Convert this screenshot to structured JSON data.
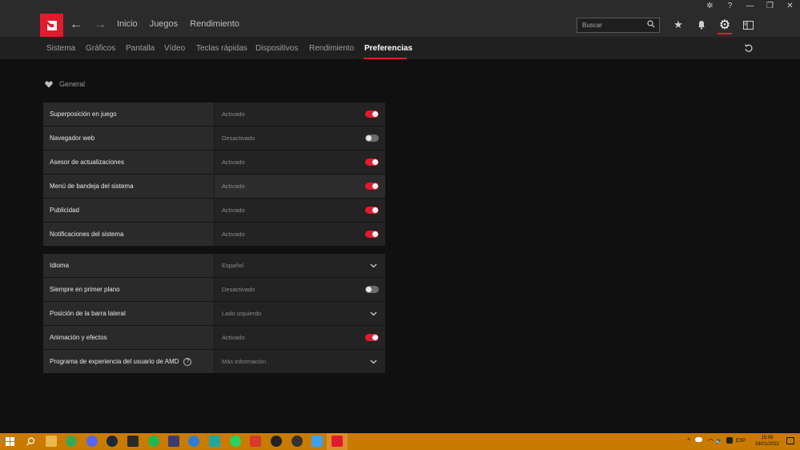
{
  "window": {
    "controls": [
      "bug-icon",
      "help-icon",
      "minimize-icon",
      "restore-icon",
      "close-icon"
    ]
  },
  "topbar": {
    "nav": [
      "Inicio",
      "Juegos",
      "Rendimiento"
    ],
    "search_placeholder": "Buscar",
    "icons": [
      "star-icon",
      "bell-icon",
      "gear-icon",
      "sidebar-icon"
    ]
  },
  "subtabs": [
    "Sistema",
    "Gráficos",
    "Pantalla",
    "Vídeo",
    "Teclas rápidas",
    "Dispositivos",
    "Rendimiento",
    "Preferencias"
  ],
  "active_subtab": "Preferencias",
  "section": {
    "title": "General",
    "icon": "heart-icon"
  },
  "panel1": [
    {
      "label": "Superposición en juego",
      "value": "Activado",
      "control": "toggle-on"
    },
    {
      "label": "Navegador web",
      "value": "Desactivado",
      "control": "toggle-off"
    },
    {
      "label": "Asesor de actualizaciones",
      "value": "Activado",
      "control": "toggle-on"
    },
    {
      "label": "Menú de bandeja del sistema",
      "value": "Activado",
      "control": "toggle-on"
    },
    {
      "label": "Publicidad",
      "value": "Activado",
      "control": "toggle-on"
    },
    {
      "label": "Notificaciones del sistema",
      "value": "Activado",
      "control": "toggle-on"
    }
  ],
  "panel2": [
    {
      "label": "Idioma",
      "value": "Español",
      "control": "dropdown"
    },
    {
      "label": "Siempre en primer plano",
      "value": "Desactivado",
      "control": "toggle-off"
    },
    {
      "label": "Posición de la barra lateral",
      "value": "Lado izquierdo",
      "control": "dropdown"
    },
    {
      "label": "Animación y efectos",
      "value": "Activado",
      "control": "toggle-on"
    },
    {
      "label": "Programa de experiencia del usuario de AMD",
      "value": "Más información",
      "control": "dropdown"
    }
  ],
  "taskbar": {
    "lang": "ESP",
    "time": "15:06",
    "date": "18/01/2022"
  },
  "colors": {
    "accent": "#e01b2e",
    "taskbar": "#c97b00"
  }
}
